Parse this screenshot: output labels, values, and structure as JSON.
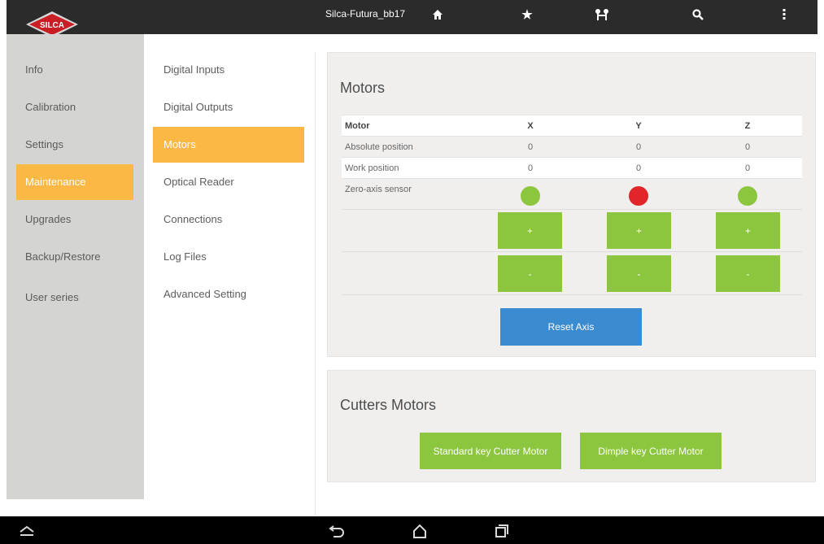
{
  "topbar": {
    "logo_text": "SILCA",
    "device_name": "Silca-Futura_bb17",
    "icons": [
      "home-icon",
      "star-icon",
      "keys-icon",
      "search-icon",
      "more-vertical-icon"
    ]
  },
  "sidebar": {
    "items": [
      {
        "label": "Info"
      },
      {
        "label": "Calibration"
      },
      {
        "label": "Settings"
      },
      {
        "label": "Maintenance"
      },
      {
        "label": "Upgrades"
      },
      {
        "label": "Backup/Restore"
      },
      {
        "label": "User series"
      }
    ],
    "active": "Maintenance"
  },
  "submenu": {
    "items": [
      {
        "label": "Digital Inputs"
      },
      {
        "label": "Digital Outputs"
      },
      {
        "label": "Motors"
      },
      {
        "label": "Optical Reader"
      },
      {
        "label": "Connections"
      },
      {
        "label": "Log Files"
      },
      {
        "label": "Advanced Setting"
      }
    ],
    "active": "Motors"
  },
  "motors": {
    "title": "Motors",
    "columns": [
      "Motor",
      "X",
      "Y",
      "Z"
    ],
    "rows": [
      {
        "label": "Absolute position",
        "x": "0",
        "y": "0",
        "z": "0"
      },
      {
        "label": "Work position",
        "x": "0",
        "y": "0",
        "z": "0"
      },
      {
        "label": "Zero-axis sensor"
      }
    ],
    "sensor_states": {
      "x": "green",
      "y": "red",
      "z": "green"
    },
    "plus_label": "+",
    "minus_label": "-",
    "reset_label": "Reset Axis"
  },
  "cutters": {
    "title": "Cutters Motors",
    "standard_label": "Standard key Cutter Motor",
    "dimple_label": "Dimple key Cutter Motor"
  },
  "colors": {
    "accent": "#fbb844",
    "green": "#8cc63f",
    "red": "#e0262a",
    "blue": "#3b8bd1",
    "topbar": "#2b2b2b",
    "sidebar": "#d4d4d2"
  },
  "navbar": {
    "icons": [
      "collapse-icon",
      "back-icon",
      "home-outline-icon",
      "recent-apps-icon"
    ]
  }
}
